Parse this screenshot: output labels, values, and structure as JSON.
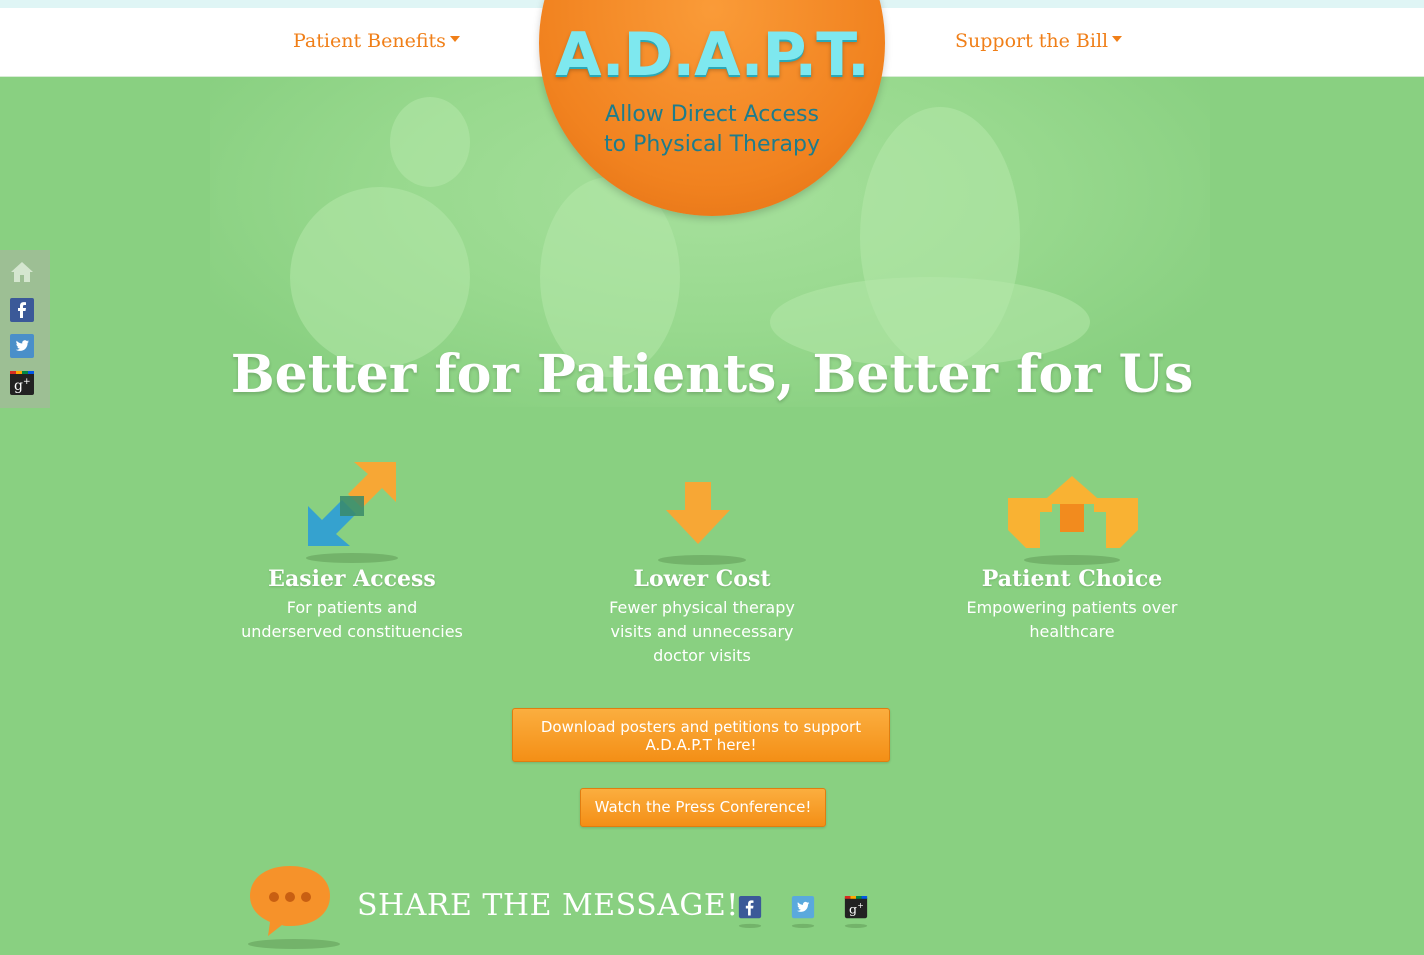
{
  "nav": {
    "left": {
      "label": "Patient Benefits"
    },
    "right": {
      "label": "Support the Bill"
    }
  },
  "logo": {
    "title": "A.D.A.P.T.",
    "subtitle_line1": "Allow Direct Access",
    "subtitle_line2": "to Physical Therapy"
  },
  "hero": {
    "headline": "Better for Patients, Better for Us"
  },
  "side_social": [
    "home-icon",
    "facebook-icon",
    "twitter-icon",
    "google-plus-icon"
  ],
  "features": [
    {
      "title": "Easier Access",
      "desc_line1": "For patients and",
      "desc_line2": "underserved constituencies",
      "desc_line3": ""
    },
    {
      "title": "Lower Cost",
      "desc_line1": "Fewer physical therapy",
      "desc_line2": "visits and unnecessary",
      "desc_line3": "doctor visits"
    },
    {
      "title": "Patient Choice",
      "desc_line1": "Empowering patients over",
      "desc_line2": "healthcare",
      "desc_line3": ""
    }
  ],
  "buttons": {
    "download_line1": "Download posters and petitions to support",
    "download_line2": "A.D.A.P.T here!",
    "press": "Watch the Press Conference!"
  },
  "share": {
    "title": "SHARE THE MESSAGE!",
    "icons": [
      "facebook-icon",
      "twitter-icon",
      "google-plus-icon"
    ]
  },
  "colors": {
    "background": "#89d081",
    "accent_orange": "#f07f18",
    "logo_teal": "#7ee8ef",
    "facebook": "#3b5998",
    "twitter": "#5aa9dd"
  }
}
